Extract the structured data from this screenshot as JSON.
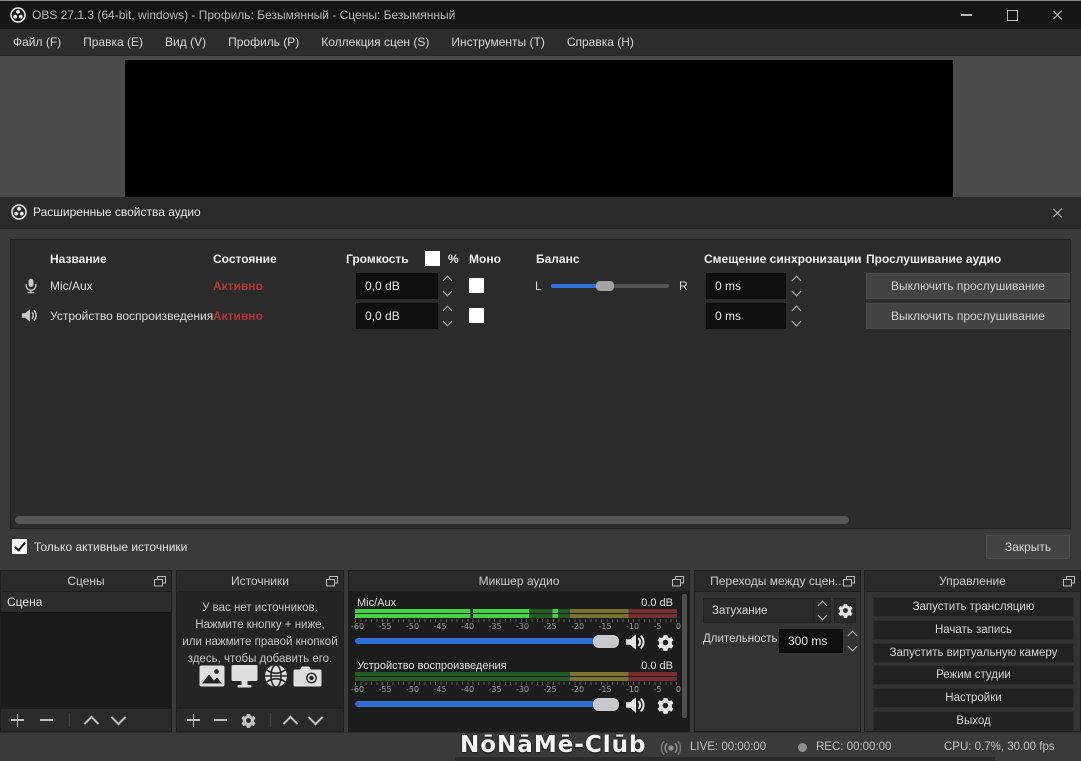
{
  "titlebar": {
    "title": "OBS 27.1.3 (64-bit, windows) - Профиль: Безымянный - Сцены: Безымянный"
  },
  "menu": {
    "items": [
      "Файл (F)",
      "Правка (E)",
      "Вид (V)",
      "Профиль (P)",
      "Коллекция сцен (S)",
      "Инструменты (T)",
      "Справка (H)"
    ]
  },
  "dialog": {
    "title": "Расширенные свойства аудио",
    "header": {
      "name": "Название",
      "status": "Состояние",
      "volume": "Громкость",
      "percent": "%",
      "mono": "Моно",
      "balance": "Баланс",
      "sync": "Смещение синхронизации",
      "monitoring": "Прослушивание аудио"
    },
    "rows": [
      {
        "name": "Mic/Aux",
        "status": "Активно",
        "volume": "0,0 dB",
        "balance_left": "L",
        "balance_right": "R",
        "sync": "0 ms",
        "monitoring_button": "Выключить прослушивание"
      },
      {
        "name": "Устройство воспроизведения",
        "status": "Активно",
        "volume": "0,0 dB",
        "sync": "0 ms",
        "monitoring_button": "Выключить прослушивание"
      }
    ],
    "active_only": "Только активные источники",
    "close": "Закрыть"
  },
  "scenes": {
    "title": "Сцены",
    "items": [
      "Сцена"
    ]
  },
  "sources": {
    "title": "Источники",
    "empty_lines": [
      "У вас нет источников.",
      "Нажмите кнопку + ниже,",
      "или нажмите правой кнопкой",
      "здесь, чтобы добавить его."
    ]
  },
  "mixer": {
    "title": "Микшер аудио",
    "channels": [
      {
        "name": "Mic/Aux",
        "db": "0.0 dB"
      },
      {
        "name": "Устройство воспроизведения",
        "db": "0.0 dB"
      }
    ],
    "scale": [
      "-60",
      "-55",
      "-50",
      "-45",
      "-40",
      "-35",
      "-30",
      "-25",
      "-20",
      "-15",
      "-10",
      "-5",
      "0"
    ]
  },
  "transitions": {
    "title": "Переходы между сцен...",
    "selected": "Затухание",
    "duration_label": "Длительность",
    "duration_value": "300 ms"
  },
  "controls": {
    "title": "Управление",
    "buttons": [
      "Запустить трансляцию",
      "Начать запись",
      "Запустить виртуальную камеру",
      "Режим студии",
      "Настройки",
      "Выход"
    ]
  },
  "statusbar": {
    "live": "LIVE: 00:00:00",
    "rec": "REC: 00:00:00",
    "cpu": "CPU: 0.7%, 30.00 fps"
  },
  "watermark": "NōNāMē-Clūb",
  "colors": {
    "accent": "#2f6fd6",
    "active_status": "#b23535",
    "meter_green": "#41d341"
  }
}
